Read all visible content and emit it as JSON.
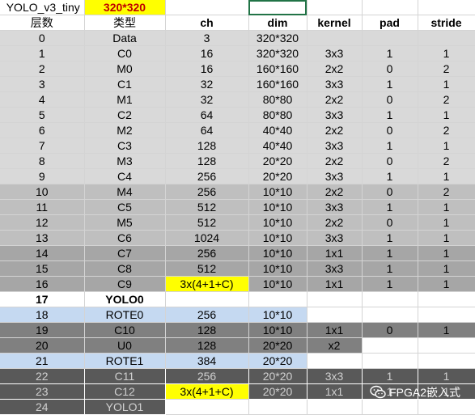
{
  "sheet": {
    "top": [
      "YOLO_v3_tiny",
      "320*320",
      "",
      "",
      "",
      "",
      ""
    ],
    "headers": [
      "层数",
      "类型",
      "ch",
      "dim",
      "kernel",
      "pad",
      "stride"
    ],
    "rows": [
      [
        "0",
        "Data",
        "3",
        "320*320",
        "",
        "",
        ""
      ],
      [
        "1",
        "C0",
        "16",
        "320*320",
        "3x3",
        "1",
        "1"
      ],
      [
        "2",
        "M0",
        "16",
        "160*160",
        "2x2",
        "0",
        "2"
      ],
      [
        "3",
        "C1",
        "32",
        "160*160",
        "3x3",
        "1",
        "1"
      ],
      [
        "4",
        "M1",
        "32",
        "80*80",
        "2x2",
        "0",
        "2"
      ],
      [
        "5",
        "C2",
        "64",
        "80*80",
        "3x3",
        "1",
        "1"
      ],
      [
        "6",
        "M2",
        "64",
        "40*40",
        "2x2",
        "0",
        "2"
      ],
      [
        "7",
        "C3",
        "128",
        "40*40",
        "3x3",
        "1",
        "1"
      ],
      [
        "8",
        "M3",
        "128",
        "20*20",
        "2x2",
        "0",
        "2"
      ],
      [
        "9",
        "C4",
        "256",
        "20*20",
        "3x3",
        "1",
        "1"
      ],
      [
        "10",
        "M4",
        "256",
        "10*10",
        "2x2",
        "0",
        "2"
      ],
      [
        "11",
        "C5",
        "512",
        "10*10",
        "3x3",
        "1",
        "1"
      ],
      [
        "12",
        "M5",
        "512",
        "10*10",
        "2x2",
        "0",
        "1"
      ],
      [
        "13",
        "C6",
        "1024",
        "10*10",
        "3x3",
        "1",
        "1"
      ],
      [
        "14",
        "C7",
        "256",
        "10*10",
        "1x1",
        "1",
        "1"
      ],
      [
        "15",
        "C8",
        "512",
        "10*10",
        "3x3",
        "1",
        "1"
      ],
      [
        "16",
        "C9",
        "3x(4+1+C)",
        "10*10",
        "1x1",
        "1",
        "1"
      ],
      [
        "17",
        "YOLO0",
        "",
        "",
        "",
        "",
        ""
      ],
      [
        "18",
        "ROTE0",
        "256",
        "10*10",
        "",
        "",
        ""
      ],
      [
        "19",
        "C10",
        "128",
        "10*10",
        "1x1",
        "0",
        "1"
      ],
      [
        "20",
        "U0",
        "128",
        "20*20",
        "x2",
        "",
        ""
      ],
      [
        "21",
        "ROTE1",
        "384",
        "20*20",
        "",
        "",
        ""
      ],
      [
        "22",
        "C11",
        "256",
        "20*20",
        "3x3",
        "1",
        "1"
      ],
      [
        "23",
        "C12",
        "3x(4+1+C)",
        "20*20",
        "1x1",
        "1",
        "1"
      ],
      [
        "24",
        "YOLO1",
        "",
        "",
        "",
        "",
        ""
      ]
    ]
  },
  "colors": {
    "light_gray": "#d9d9d9",
    "mid_gray": "#bfbfbf",
    "dark_gray": "#a6a6a6",
    "darker_gray": "#808080",
    "darkest_gray": "#595959",
    "light_blue": "#c5d9f1",
    "highlight_yellow": "#ffff00",
    "highlight_text_red": "#c00000",
    "selection_green": "#217346"
  },
  "watermark": {
    "text": "FPGA2嵌入式",
    "icon": "wechat-icon"
  }
}
